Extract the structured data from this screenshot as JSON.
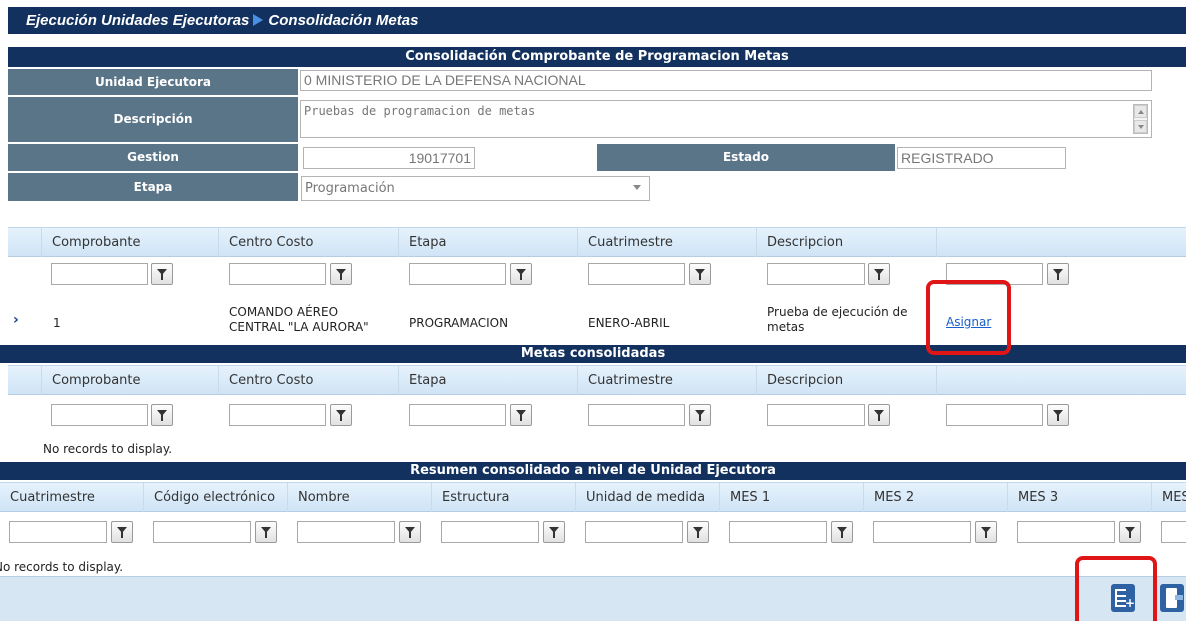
{
  "breadcrumb": {
    "section": "Ejecución Unidades Ejecutoras",
    "page": "Consolidación Metas"
  },
  "form": {
    "title": "Consolidación Comprobante de Programacion Metas",
    "unidad_label": "Unidad Ejecutora",
    "unidad_value": "0 MINISTERIO DE LA DEFENSA NACIONAL",
    "descripcion_label": "Descripción",
    "descripcion_value": "Pruebas de programacion de metas",
    "gestion_label": "Gestion",
    "gestion_value": "19017701",
    "estado_label": "Estado",
    "estado_value": "REGISTRADO",
    "etapa_label": "Etapa",
    "etapa_value": "Programación"
  },
  "grid1": {
    "columns": [
      "Comprobante",
      "Centro Costo",
      "Etapa",
      "Cuatrimestre",
      "Descripcion"
    ],
    "row": {
      "comprobante": "1",
      "centro_line1": "COMANDO AÉREO",
      "centro_line2": "CENTRAL \"LA AURORA\"",
      "etapa": "PROGRAMACION",
      "cuatrimestre": "ENERO-ABRIL",
      "desc_line1": "Prueba de ejecución de",
      "desc_line2": "metas",
      "action": "Asignar"
    }
  },
  "grid2": {
    "title": "Metas consolidadas",
    "columns": [
      "Comprobante",
      "Centro Costo",
      "Etapa",
      "Cuatrimestre",
      "Descripcion"
    ],
    "empty": "No records to display."
  },
  "grid3": {
    "title": "Resumen consolidado a nivel de Unidad Ejecutora",
    "columns": [
      "Cuatrimestre",
      "Código electrónico",
      "Nombre",
      "Estructura",
      "Unidad de medida",
      "MES 1",
      "MES 2",
      "MES 3",
      "MES"
    ],
    "empty": "No records to display."
  },
  "icons": {
    "filter": "filter-funnel-icon",
    "expand": "chevron-right-icon",
    "add": "add-record-icon",
    "exit": "exit-door-icon"
  },
  "colors": {
    "navy": "#13315f",
    "label_bg": "#5a7588",
    "highlight": "#e01515",
    "link": "#1a5fcc"
  }
}
